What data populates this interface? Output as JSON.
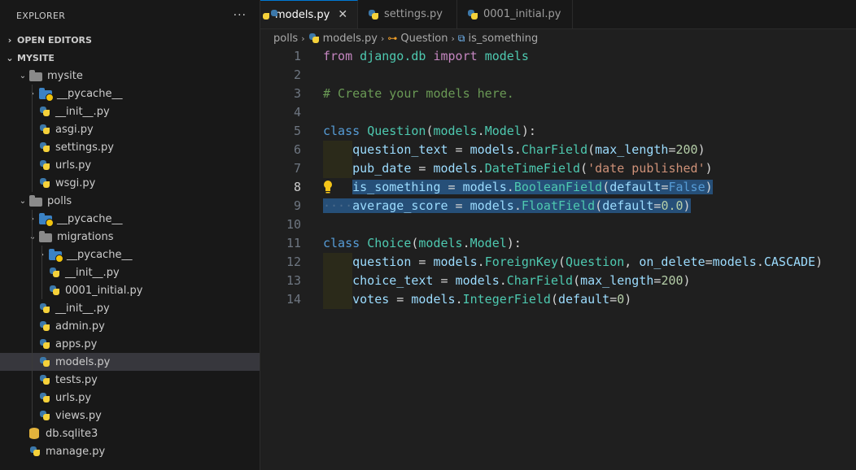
{
  "sidebar": {
    "title": "EXPLORER",
    "more": "···",
    "open_editors": "OPEN EDITORS",
    "project": "MYSITE",
    "tree": [
      {
        "label": "mysite",
        "kind": "folder-open",
        "depth": 1
      },
      {
        "label": "__pycache__",
        "kind": "pycache-closed",
        "depth": 2
      },
      {
        "label": "__init__.py",
        "kind": "py",
        "depth": 2
      },
      {
        "label": "asgi.py",
        "kind": "py",
        "depth": 2
      },
      {
        "label": "settings.py",
        "kind": "py",
        "depth": 2
      },
      {
        "label": "urls.py",
        "kind": "py",
        "depth": 2
      },
      {
        "label": "wsgi.py",
        "kind": "py",
        "depth": 2
      },
      {
        "label": "polls",
        "kind": "folder-open",
        "depth": 1
      },
      {
        "label": "__pycache__",
        "kind": "pycache-closed",
        "depth": 2
      },
      {
        "label": "migrations",
        "kind": "folder-open",
        "depth": 2
      },
      {
        "label": "__pycache__",
        "kind": "pycache-closed",
        "depth": 3
      },
      {
        "label": "__init__.py",
        "kind": "py",
        "depth": 3
      },
      {
        "label": "0001_initial.py",
        "kind": "py",
        "depth": 3
      },
      {
        "label": "__init__.py",
        "kind": "py",
        "depth": 2
      },
      {
        "label": "admin.py",
        "kind": "py",
        "depth": 2
      },
      {
        "label": "apps.py",
        "kind": "py",
        "depth": 2
      },
      {
        "label": "models.py",
        "kind": "py",
        "depth": 2,
        "selected": true
      },
      {
        "label": "tests.py",
        "kind": "py",
        "depth": 2
      },
      {
        "label": "urls.py",
        "kind": "py",
        "depth": 2
      },
      {
        "label": "views.py",
        "kind": "py",
        "depth": 2
      },
      {
        "label": "db.sqlite3",
        "kind": "db",
        "depth": 1
      },
      {
        "label": "manage.py",
        "kind": "py",
        "depth": 1
      }
    ]
  },
  "tabs": [
    {
      "label": "models.py",
      "active": true,
      "close": "✕"
    },
    {
      "label": "settings.py",
      "active": false
    },
    {
      "label": "0001_initial.py",
      "active": false
    }
  ],
  "breadcrumb": {
    "folder": "polls",
    "file": "models.py",
    "class": "Question",
    "field": "is_something"
  },
  "editor": {
    "current_line": 8,
    "lines": [
      {
        "n": "1",
        "tokens": [
          [
            "imp",
            "from"
          ],
          [
            "op",
            " "
          ],
          [
            "cls",
            "django.db"
          ],
          [
            "op",
            " "
          ],
          [
            "imp",
            "import"
          ],
          [
            "op",
            " "
          ],
          [
            "cls",
            "models"
          ]
        ]
      },
      {
        "n": "2",
        "tokens": []
      },
      {
        "n": "3",
        "tokens": [
          [
            "cmt",
            "# Create your models here."
          ]
        ]
      },
      {
        "n": "4",
        "tokens": []
      },
      {
        "n": "5",
        "tokens": [
          [
            "kw",
            "class"
          ],
          [
            "op",
            " "
          ],
          [
            "cls",
            "Question"
          ],
          [
            "op",
            "("
          ],
          [
            "cls",
            "models"
          ],
          [
            "op",
            "."
          ],
          [
            "cls",
            "Model"
          ],
          [
            "op",
            "):"
          ]
        ]
      },
      {
        "n": "6",
        "indent": true,
        "tokens": [
          [
            "op",
            "    "
          ],
          [
            "var",
            "question_text"
          ],
          [
            "op",
            " = "
          ],
          [
            "var",
            "models"
          ],
          [
            "op",
            "."
          ],
          [
            "cls",
            "CharField"
          ],
          [
            "op",
            "("
          ],
          [
            "var",
            "max_length"
          ],
          [
            "op",
            "="
          ],
          [
            "num",
            "200"
          ],
          [
            "op",
            ")"
          ]
        ]
      },
      {
        "n": "7",
        "indent": true,
        "tokens": [
          [
            "op",
            "    "
          ],
          [
            "var",
            "pub_date"
          ],
          [
            "op",
            " = "
          ],
          [
            "var",
            "models"
          ],
          [
            "op",
            "."
          ],
          [
            "cls",
            "DateTimeField"
          ],
          [
            "op",
            "("
          ],
          [
            "str",
            "'date published'"
          ],
          [
            "op",
            ")"
          ]
        ]
      },
      {
        "n": "8",
        "bulb": true,
        "tokens": [
          [
            "op",
            "    "
          ],
          [
            "var",
            "is_something",
            "sel"
          ],
          [
            "op",
            " = ",
            "sel"
          ],
          [
            "var",
            "models",
            "sel"
          ],
          [
            "op",
            ".",
            "sel"
          ],
          [
            "cls",
            "BooleanField",
            "sel"
          ],
          [
            "op",
            "(",
            "sel"
          ],
          [
            "var",
            "default",
            "sel"
          ],
          [
            "op",
            "=",
            "sel"
          ],
          [
            "kw",
            "False",
            "sel"
          ],
          [
            "op",
            ")",
            "sel"
          ]
        ]
      },
      {
        "n": "9",
        "tokens": [
          [
            "op",
            "····",
            "sel"
          ],
          [
            "var",
            "average_score",
            "sel"
          ],
          [
            "op",
            " = ",
            "sel"
          ],
          [
            "var",
            "models",
            "sel"
          ],
          [
            "op",
            ".",
            "sel"
          ],
          [
            "cls",
            "FloatField",
            "sel"
          ],
          [
            "op",
            "(",
            "sel"
          ],
          [
            "var",
            "default",
            "sel"
          ],
          [
            "op",
            "=",
            "sel"
          ],
          [
            "num",
            "0.0",
            "sel"
          ],
          [
            "op",
            ")",
            "sel"
          ]
        ]
      },
      {
        "n": "10",
        "tokens": []
      },
      {
        "n": "11",
        "tokens": [
          [
            "kw",
            "class"
          ],
          [
            "op",
            " "
          ],
          [
            "cls",
            "Choice"
          ],
          [
            "op",
            "("
          ],
          [
            "cls",
            "models"
          ],
          [
            "op",
            "."
          ],
          [
            "cls",
            "Model"
          ],
          [
            "op",
            "):"
          ]
        ]
      },
      {
        "n": "12",
        "indent": true,
        "tokens": [
          [
            "op",
            "    "
          ],
          [
            "var",
            "question"
          ],
          [
            "op",
            " = "
          ],
          [
            "var",
            "models"
          ],
          [
            "op",
            "."
          ],
          [
            "cls",
            "ForeignKey"
          ],
          [
            "op",
            "("
          ],
          [
            "cls",
            "Question"
          ],
          [
            "op",
            ", "
          ],
          [
            "var",
            "on_delete"
          ],
          [
            "op",
            "="
          ],
          [
            "var",
            "models"
          ],
          [
            "op",
            "."
          ],
          [
            "var",
            "CASCADE"
          ],
          [
            "op",
            ")"
          ]
        ]
      },
      {
        "n": "13",
        "indent": true,
        "tokens": [
          [
            "op",
            "    "
          ],
          [
            "var",
            "choice_text"
          ],
          [
            "op",
            " = "
          ],
          [
            "var",
            "models"
          ],
          [
            "op",
            "."
          ],
          [
            "cls",
            "CharField"
          ],
          [
            "op",
            "("
          ],
          [
            "var",
            "max_length"
          ],
          [
            "op",
            "="
          ],
          [
            "num",
            "200"
          ],
          [
            "op",
            ")"
          ]
        ]
      },
      {
        "n": "14",
        "indent": true,
        "tokens": [
          [
            "op",
            "    "
          ],
          [
            "var",
            "votes"
          ],
          [
            "op",
            " = "
          ],
          [
            "var",
            "models"
          ],
          [
            "op",
            "."
          ],
          [
            "cls",
            "IntegerField"
          ],
          [
            "op",
            "("
          ],
          [
            "var",
            "default"
          ],
          [
            "op",
            "="
          ],
          [
            "num",
            "0"
          ],
          [
            "op",
            ")"
          ]
        ]
      }
    ]
  }
}
